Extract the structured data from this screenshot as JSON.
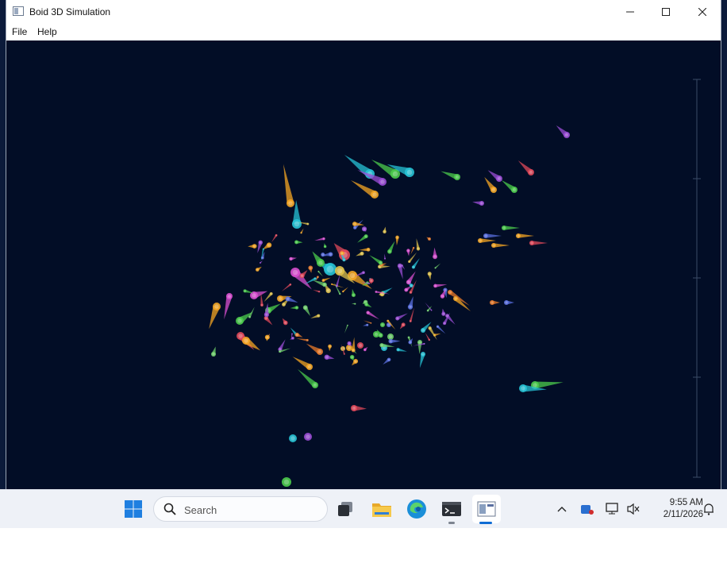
{
  "window": {
    "title": "Boid 3D Simulation",
    "controls": {
      "minimize": "minimize-icon",
      "maximize": "maximize-icon",
      "close": "close-icon"
    }
  },
  "menu": [
    "File",
    "Help"
  ],
  "scene": {
    "background": "#020d26",
    "palette": [
      "#f5a623",
      "#27c3d6",
      "#4ccc4c",
      "#9b4dd6",
      "#e0485a",
      "#e87a2a",
      "#e0c24a",
      "#d94fd0",
      "#5a6fe0",
      "#6fd06a"
    ]
  },
  "taskbar": {
    "search_placeholder": "Search",
    "icons": [
      "start-icon",
      "search-icon",
      "task-view-icon",
      "file-explorer-icon",
      "edge-icon",
      "terminal-icon",
      "boid-app-icon"
    ],
    "tray_icons": [
      "chevron-up-icon",
      "bluetooth-icon",
      "network-icon",
      "volume-muted-icon",
      "notification-icon"
    ],
    "time": "9:55 AM",
    "date": "2/11/2026"
  }
}
